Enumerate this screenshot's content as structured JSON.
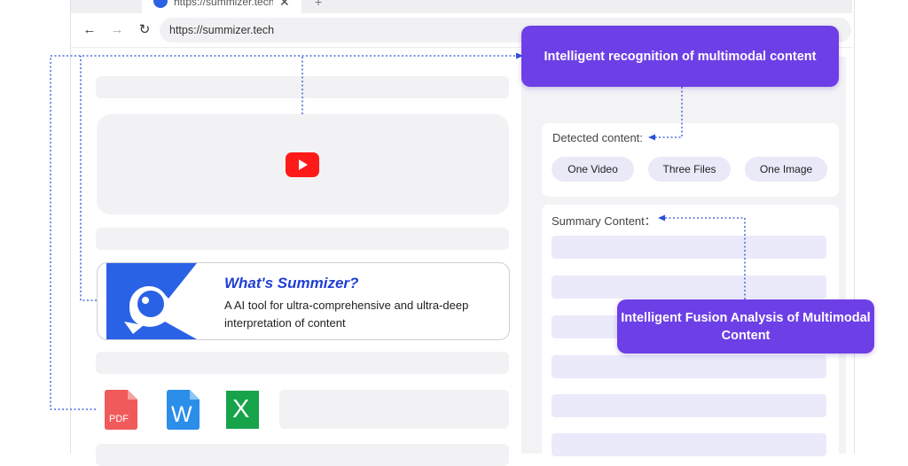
{
  "browser": {
    "tab_title": "https://summizer.tech",
    "tab_close_glyph": "✕",
    "tab_new_glyph": "+",
    "back_glyph": "←",
    "forward_glyph": "→",
    "reload_glyph": "↻",
    "url": "https://summizer.tech"
  },
  "card": {
    "title": "What's Summizer?",
    "description": "A AI tool for ultra-comprehensive and ultra-deep interpretation of content"
  },
  "files": {
    "pdf_label": "PDF",
    "word_label": "W",
    "excel_label": "X"
  },
  "panel": {
    "detected_label": "Detected content:",
    "chips": [
      "One Video",
      "Three Files",
      "One Image"
    ],
    "summary_label": "Summary Content："
  },
  "callouts": {
    "recognition": "Intelligent recognition of multimodal content",
    "fusion": "Intelligent Fusion Analysis of Multimodal Content"
  },
  "colors": {
    "accent_purple": "#6d3fe6",
    "link_blue": "#1f3fd4",
    "logo_blue": "#2a62e6",
    "youtube_red": "#ff1a1a",
    "pdf_red": "#f05a5a",
    "word_blue": "#2b8ee8",
    "excel_green": "#16a34a"
  },
  "icons": {
    "tab_favicon": "summizer-logo-icon",
    "youtube": "youtube-play-icon",
    "pdf": "pdf-file-icon",
    "word": "word-file-icon",
    "excel": "excel-file-icon"
  }
}
